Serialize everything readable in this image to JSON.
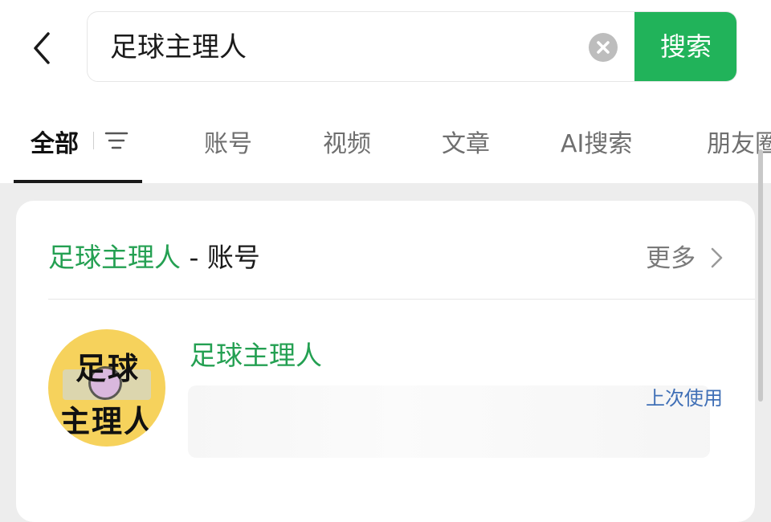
{
  "search": {
    "query": "足球主理人",
    "button_label": "搜索"
  },
  "tabs": [
    {
      "label": "全部",
      "active": true
    },
    {
      "label": "账号",
      "active": false
    },
    {
      "label": "视频",
      "active": false
    },
    {
      "label": "文章",
      "active": false
    },
    {
      "label": "AI搜索",
      "active": false
    },
    {
      "label": "朋友圈",
      "active": false
    }
  ],
  "section": {
    "keyword": "足球主理人",
    "suffix": " - 账号",
    "more_label": "更多"
  },
  "account": {
    "name": "足球主理人",
    "avatar_line1": "足球",
    "avatar_line2": "主理人",
    "recent_tag": "上次使用"
  },
  "icons": {
    "back": "chevron-left-icon",
    "clear": "clear-circle-icon",
    "filter": "filter-icon",
    "more": "chevron-right-icon"
  },
  "colors": {
    "accent_green": "#21b35a",
    "keyword_green": "#24a052",
    "link_blue": "#3f6fb6",
    "avatar_yellow": "#f6d25c"
  }
}
